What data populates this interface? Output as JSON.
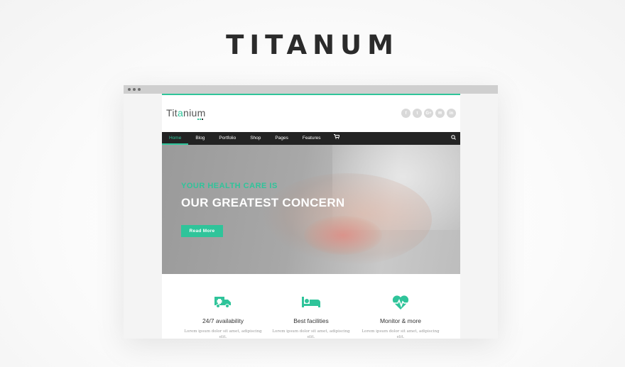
{
  "page": {
    "title": "TITANUM"
  },
  "site": {
    "logo": {
      "prefix": "Tit",
      "accent": "a",
      "suffix": "nium"
    },
    "socials": [
      {
        "icon": "facebook-icon",
        "glyph": "f"
      },
      {
        "icon": "twitter-icon",
        "glyph": "t"
      },
      {
        "icon": "google-plus-icon",
        "glyph": "G+"
      },
      {
        "icon": "email-icon",
        "glyph": "✉"
      },
      {
        "icon": "linkedin-icon",
        "glyph": "in"
      }
    ],
    "nav": {
      "items": [
        {
          "label": "Home",
          "active": true
        },
        {
          "label": "Blog"
        },
        {
          "label": "Portfolio"
        },
        {
          "label": "Shop"
        },
        {
          "label": "Pages"
        },
        {
          "label": "Features"
        }
      ],
      "cart_icon": "cart-icon",
      "search_icon": "search-icon"
    },
    "hero": {
      "subtitle": "YOUR HEALTH CARE IS",
      "title": "OUR GREATEST CONCERN",
      "button": "Read More"
    },
    "features": [
      {
        "icon": "ambulance-icon",
        "title": "24/7 availability",
        "text": "Lorem ipsum dolor sit amet, adipiscing elit."
      },
      {
        "icon": "bed-icon",
        "title": "Best facilities",
        "text": "Lorem ipsum dolor sit amet, adipiscing elit."
      },
      {
        "icon": "heart-monitor-icon",
        "title": "Monitor & more",
        "text": "Lorem ipsum dolor sit amet, adipiscing elit."
      }
    ]
  },
  "colors": {
    "accent": "#2fc49a",
    "nav": "#232323",
    "title": "#2b2b2b"
  }
}
